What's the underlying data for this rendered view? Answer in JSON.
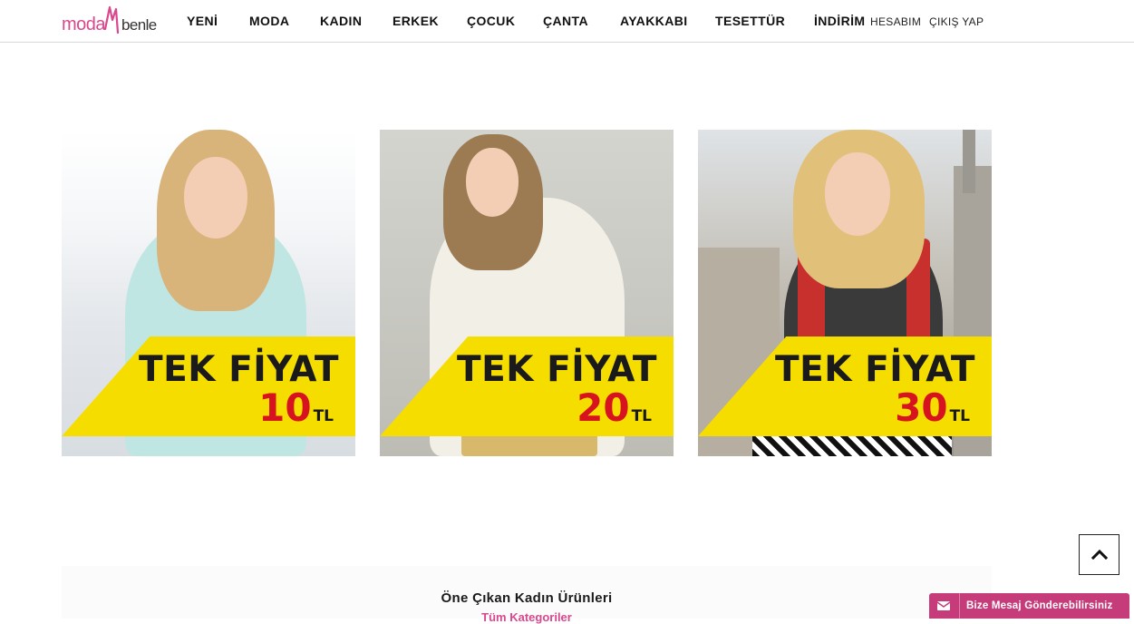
{
  "header": {
    "logo_text_left": "moda",
    "logo_text_right": "benle",
    "nav": [
      "YENİ",
      "MODA",
      "KADIN",
      "ERKEK",
      "ÇOCUK",
      "ÇANTA",
      "AYAKKABI",
      "TESETTÜR",
      "İNDİRİM"
    ],
    "account": "HESABIM",
    "logout": "ÇIKIŞ YAP"
  },
  "banners": [
    {
      "headline": "TEK FİYAT",
      "price": "10",
      "currency": "TL"
    },
    {
      "headline": "TEK FİYAT",
      "price": "20",
      "currency": "TL"
    },
    {
      "headline": "TEK FİYAT",
      "price": "30",
      "currency": "TL"
    }
  ],
  "featured": {
    "title": "Öne Çıkan Kadın Ürünleri",
    "link": "Tüm Kategoriler"
  },
  "message_button": {
    "label": "Bize Mesaj Gönderebilirsiniz",
    "icon": "envelope-icon"
  },
  "scroll_top": {
    "icon": "chevron-up-icon"
  },
  "colors": {
    "brand_pink": "#d9488e",
    "promo_yellow": "#f6dd00",
    "price_red": "#d7131f",
    "message_bg": "#c63c7a"
  }
}
